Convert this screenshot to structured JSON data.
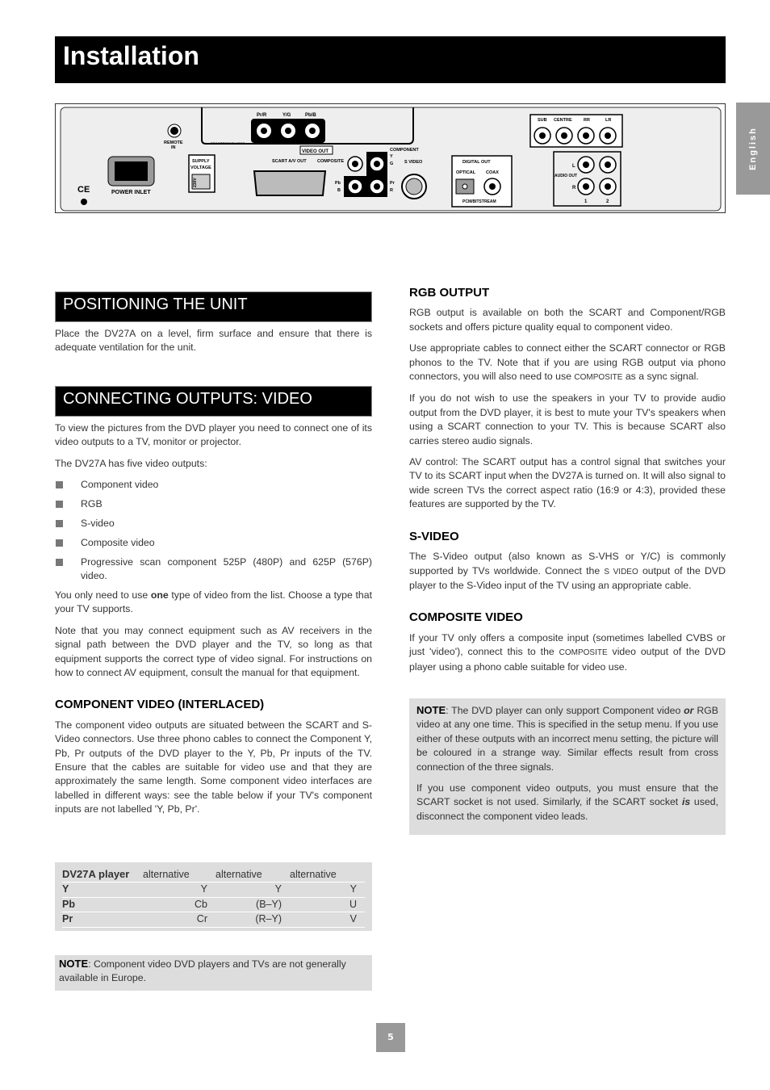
{
  "header": {
    "title": "Installation",
    "side_tab": "English"
  },
  "panel": {
    "remote": "REMOTE",
    "remote2": "IN",
    "power": "POWER INLET",
    "supply1": "SUPPLY",
    "supply2": "VOLTAGE",
    "volt": "230V",
    "prog": "PROGRESSIVE VIDEO",
    "pr_r": "Pr/R",
    "y_g": "Y/G",
    "pb_b": "Pb/B",
    "video_out": "VIDEO OUT",
    "scart": "SCART A/V OUT",
    "composite": "COMPOSITE",
    "component": "COMPONENT",
    "y": "Y",
    "g": "G",
    "pb": "Pb",
    "b": "B",
    "pr": "Pr",
    "r": "R",
    "svideo": "S VIDEO",
    "digital": "DIGITAL OUT",
    "optical": "OPTICAL",
    "coax": "COAX",
    "pcm": "PCM/BITSTREAM",
    "sub": "SUB",
    "centre": "CENTRE",
    "rr": "RR",
    "lr": "LR",
    "l": "L",
    "audio_out": "AUDIO OUT",
    "ar": "R",
    "n1": "1",
    "n2": "2",
    "ce": "CE"
  },
  "left": {
    "pos_head": "POSITIONING THE UNIT",
    "pos_p": "Place the DV27A on a level, firm surface and ensure that there is adequate ventilation for the unit.",
    "conn_head": "CONNECTING OUTPUTS: VIDEO",
    "conn_p1": "To view the pictures from the DVD player you need to connect one of its video outputs to a TV, monitor or projector.",
    "conn_p2": "The DV27A has five video outputs:",
    "outputs": [
      "Component video",
      "RGB",
      "S-video",
      "Composite video",
      "Progressive scan component 525P (480P) and 625P (576P) video."
    ],
    "conn_p3a": "You only need to use ",
    "conn_p3b": "one",
    "conn_p3c": " type of video from the list. Choose a type that your TV supports.",
    "conn_p4": "Note that you may connect equipment such as AV receivers in the signal path between the DVD player and the TV, so long as that equipment supports the correct type of video signal. For instructions on how to connect AV equipment, consult the manual for that equipment.",
    "comp_head": "COMPONENT VIDEO (INTERLACED)",
    "comp_p": "The component video outputs are situated between the SCART and S-Video connectors. Use three phono cables to connect the Component Y, Pb, Pr outputs of the DVD player to the Y, Pb, Pr inputs of the TV. Ensure that the cables are suitable for video use and that they are approximately the same length. Some component video interfaces are labelled in different ways: see the table below if your TV's component inputs are not labelled 'Y, Pb, Pr'.",
    "table": {
      "headers": [
        "DV27A player",
        "alternative",
        "alternative",
        "alternative"
      ],
      "rows": [
        [
          "Y",
          "Y",
          "Y",
          "Y"
        ],
        [
          "Pb",
          "Cb",
          "(B–Y)",
          "U"
        ],
        [
          "Pr",
          "Cr",
          "(R–Y)",
          "V"
        ]
      ]
    },
    "note_label": "NOTE",
    "note_text": ": Component video DVD players and TVs are not generally available in Europe."
  },
  "right": {
    "rgb_head": "RGB OUTPUT",
    "rgb_p1": "RGB output is available on both the SCART and Component/RGB sockets and offers picture quality equal to component video.",
    "rgb_p2a": "Use appropriate cables to connect either the SCART connector or RGB phonos to the TV. Note that if you are using RGB output via phono connectors, you will also need to use ",
    "rgb_p2b": "Composite",
    "rgb_p2c": " as a sync signal.",
    "rgb_p3": "If you do not wish to use the speakers in your TV to provide audio output from the DVD player, it is best to mute your TV's speakers when using a SCART connection to your TV. This is because SCART also carries stereo audio signals.",
    "rgb_p4": "AV control: The SCART output has a control signal that switches your TV to its SCART input when the DV27A is turned on. It will also signal to wide screen TVs the correct aspect ratio (16:9 or 4:3), provided these features are supported by the TV.",
    "sv_head": "S-VIDEO",
    "sv_pa": "The S-Video output (also known as S-VHS or Y/C) is commonly supported by TVs worldwide. Connect the ",
    "sv_pb": "S Video",
    "sv_pc": " output of the DVD player to the S-Video input of the TV using an appropriate  cable.",
    "cv_head": "COMPOSITE VIDEO",
    "cv_pa": "If your TV only offers a composite input (sometimes labelled CVBS or just 'video'), connect this to the ",
    "cv_pb": "Composite",
    "cv_pc": " video output of the DVD player using a phono cable suitable for video use.",
    "note_label": "NOTE",
    "note1a": ": The DVD player can only support Component video ",
    "note1b": "or",
    "note1c": " RGB video at any one time. This is specified in the setup menu. If you use either of these outputs with an incorrect menu setting, the picture will be coloured in a strange way. Similar effects result from cross connection of the three signals.",
    "note2a": "If you use component video outputs, you must ensure that  the SCART socket is not used. Similarly, if the SCART socket ",
    "note2b": "is",
    "note2c": " used, disconnect the component video leads."
  },
  "page_number": "5"
}
